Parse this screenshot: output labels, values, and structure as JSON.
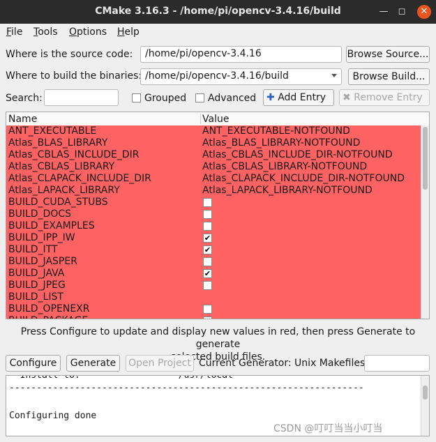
{
  "window": {
    "title": "CMake 3.16.3 - /home/pi/opencv-3.4.16/build"
  },
  "menu": {
    "items": [
      "File",
      "Tools",
      "Options",
      "Help"
    ]
  },
  "source": {
    "label": "Where is the source code:",
    "value": "/home/pi/opencv-3.4.16",
    "browse": "Browse Source..."
  },
  "binaries": {
    "label": "Where to build the binaries:",
    "value": "/home/pi/opencv-3.4.16/build",
    "browse": "Browse Build..."
  },
  "search": {
    "label": "Search:",
    "value": ""
  },
  "toolbar": {
    "grouped": "Grouped",
    "advanced": "Advanced",
    "add_entry": "Add Entry",
    "remove_entry": "Remove Entry"
  },
  "table": {
    "headers": {
      "name": "Name",
      "value": "Value"
    },
    "rows": [
      {
        "name": "ANT_EXECUTABLE",
        "value": "ANT_EXECUTABLE-NOTFOUND",
        "type": "text"
      },
      {
        "name": "Atlas_BLAS_LIBRARY",
        "value": "Atlas_BLAS_LIBRARY-NOTFOUND",
        "type": "text"
      },
      {
        "name": "Atlas_CBLAS_INCLUDE_DIR",
        "value": "Atlas_CBLAS_INCLUDE_DIR-NOTFOUND",
        "type": "text"
      },
      {
        "name": "Atlas_CBLAS_LIBRARY",
        "value": "Atlas_CBLAS_LIBRARY-NOTFOUND",
        "type": "text"
      },
      {
        "name": "Atlas_CLAPACK_INCLUDE_DIR",
        "value": "Atlas_CLAPACK_INCLUDE_DIR-NOTFOUND",
        "type": "text"
      },
      {
        "name": "Atlas_LAPACK_LIBRARY",
        "value": "Atlas_LAPACK_LIBRARY-NOTFOUND",
        "type": "text"
      },
      {
        "name": "BUILD_CUDA_STUBS",
        "value": "",
        "type": "bool",
        "checked": false
      },
      {
        "name": "BUILD_DOCS",
        "value": "",
        "type": "bool",
        "checked": false
      },
      {
        "name": "BUILD_EXAMPLES",
        "value": "",
        "type": "bool",
        "checked": false
      },
      {
        "name": "BUILD_IPP_IW",
        "value": "",
        "type": "bool",
        "checked": true
      },
      {
        "name": "BUILD_ITT",
        "value": "",
        "type": "bool",
        "checked": true
      },
      {
        "name": "BUILD_JASPER",
        "value": "",
        "type": "bool",
        "checked": false
      },
      {
        "name": "BUILD_JAVA",
        "value": "",
        "type": "bool",
        "checked": true
      },
      {
        "name": "BUILD_JPEG",
        "value": "",
        "type": "bool",
        "checked": false
      },
      {
        "name": "BUILD_LIST",
        "value": "",
        "type": "text"
      },
      {
        "name": "BUILD_OPENEXR",
        "value": "",
        "type": "bool",
        "checked": false
      },
      {
        "name": "BUILD_PACKAGE",
        "value": "",
        "type": "bool",
        "checked": true
      }
    ]
  },
  "message": {
    "line1": "Press Configure to update and display new values in red, then press Generate to generate",
    "line2": "selected build files."
  },
  "actions": {
    "configure": "Configure",
    "generate": "Generate",
    "open_project": "Open Project",
    "generator_label": "Current Generator: Unix Makefiles",
    "generator_value": ""
  },
  "output": {
    "line1": "  Install to:                  /usr/local",
    "line2": "-----------------------------------------------------------------",
    "line3": "",
    "line4": "Configuring done"
  },
  "watermark": "CSDN @叮叮当当小叮当",
  "colors": {
    "changed_row": "#ff6262",
    "titlebar": "#2b2b2b",
    "close": "#e95420"
  }
}
